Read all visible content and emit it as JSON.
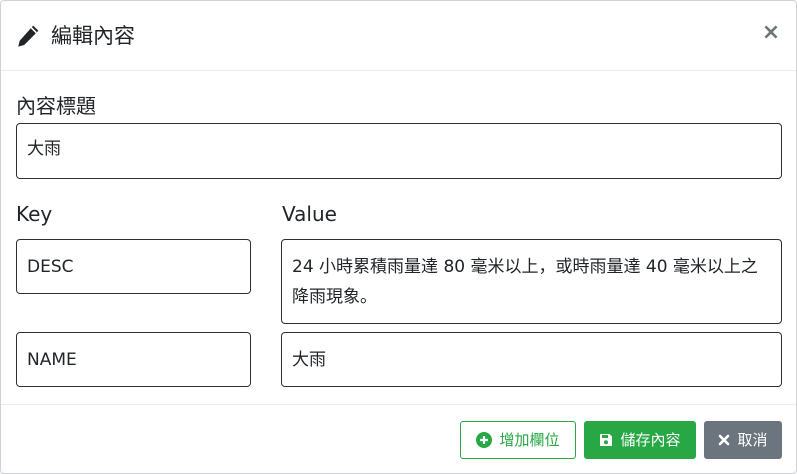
{
  "header": {
    "title": "編輯內容",
    "close_label": "×"
  },
  "form": {
    "content_title_label": "內容標題",
    "content_title_value": "大雨",
    "key_label": "Key",
    "value_label": "Value",
    "rows": [
      {
        "key": "DESC",
        "value": "24 小時累積雨量達 80 毫米以上，或時雨量達 40 毫米以上之降雨現象。"
      },
      {
        "key": "NAME",
        "value": "大雨"
      }
    ]
  },
  "footer": {
    "add_field_label": "增加欄位",
    "save_label": "儲存內容",
    "cancel_label": "取消"
  },
  "colors": {
    "success": "#28a745",
    "secondary": "#6c757d",
    "text": "#212529"
  },
  "icons": {
    "header": "pencil-icon",
    "add": "plus-circle-icon",
    "save": "floppy-disk-icon",
    "cancel": "x-icon"
  }
}
